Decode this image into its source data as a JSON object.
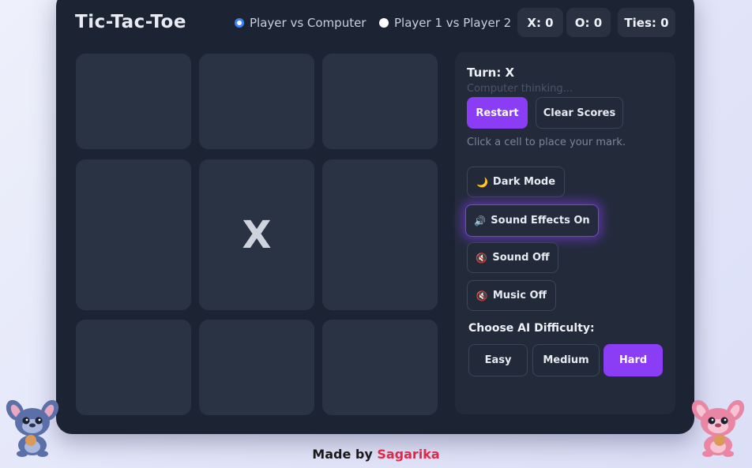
{
  "app": {
    "title": "Tic-Tac-Toe"
  },
  "modes": [
    {
      "label": "Player vs Computer",
      "selected": true
    },
    {
      "label": "Player 1 vs Player 2",
      "selected": false
    }
  ],
  "scores": {
    "x": "X: 0",
    "o": "O: 0",
    "ties": "Ties: 0"
  },
  "board": {
    "cells": [
      "",
      "",
      "",
      "",
      "X",
      "",
      "",
      "",
      ""
    ]
  },
  "panel": {
    "turn": "Turn: X",
    "status": "Computer thinking...",
    "restart_label": "Restart",
    "clear_label": "Clear Scores",
    "hint": "Click a cell to place your mark.",
    "dark_mode_label": "Dark Mode",
    "sound_effects_label": "Sound Effects On",
    "sound_off_label": "Sound Off",
    "music_off_label": "Music Off",
    "difficulty_label": "Choose AI Difficulty:",
    "difficulties": [
      "Easy",
      "Medium",
      "Hard"
    ],
    "selected_difficulty": "Hard"
  },
  "footer": {
    "prefix": "Made by",
    "author": "Sagarika"
  },
  "colors": {
    "accent": "#8b3df6",
    "panel": "#232b3b",
    "cell": "#2a3344",
    "author": "#e0284a"
  }
}
